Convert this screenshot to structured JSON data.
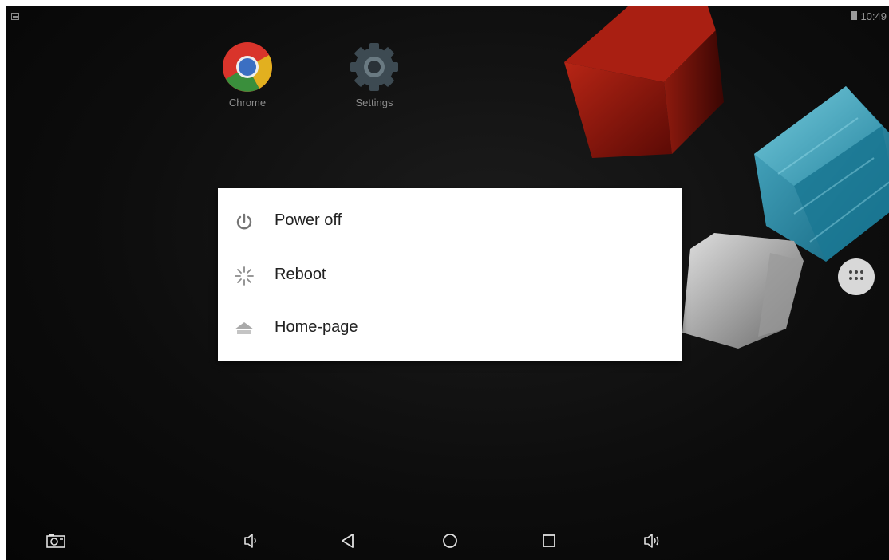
{
  "status_bar": {
    "notification_icon": "screenshot-notification-icon",
    "battery_icon": "battery-icon",
    "time": "10:49"
  },
  "desktop": {
    "apps": [
      {
        "label": "Chrome",
        "icon": "chrome-icon"
      },
      {
        "label": "Settings",
        "icon": "settings-gear-icon"
      }
    ],
    "app_drawer_icon": "apps-grid-icon"
  },
  "power_menu": {
    "items": [
      {
        "label": "Power off",
        "icon": "power-icon"
      },
      {
        "label": "Reboot",
        "icon": "reboot-spinner-icon"
      },
      {
        "label": "Home-page",
        "icon": "home-icon"
      }
    ]
  },
  "nav_bar": {
    "buttons": [
      {
        "name": "screenshot",
        "icon": "camera-icon"
      },
      {
        "name": "volume-down",
        "icon": "volume-down-icon"
      },
      {
        "name": "back",
        "icon": "back-triangle-icon"
      },
      {
        "name": "home",
        "icon": "home-circle-icon"
      },
      {
        "name": "recents",
        "icon": "recents-square-icon"
      },
      {
        "name": "volume-up",
        "icon": "volume-up-icon"
      }
    ]
  },
  "colors": {
    "dialog_bg": "#ffffff",
    "menu_text": "#212121",
    "icon_gray": "#757575",
    "nav_icon": "#e0e0e0"
  }
}
